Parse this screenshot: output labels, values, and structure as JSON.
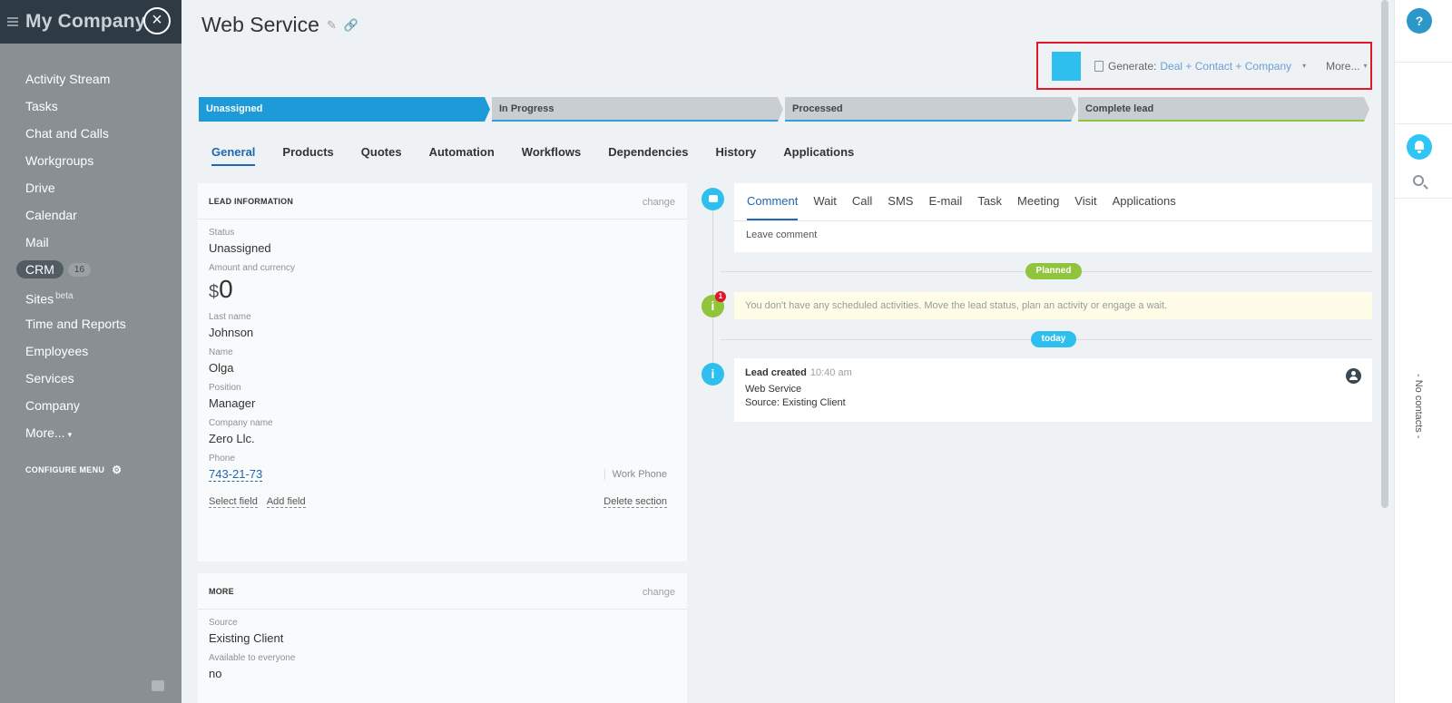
{
  "sidebar": {
    "company": "My Company",
    "close_icon": "×",
    "items": [
      {
        "label": "Activity Stream"
      },
      {
        "label": "Tasks"
      },
      {
        "label": "Chat and Calls"
      },
      {
        "label": "Workgroups"
      },
      {
        "label": "Drive"
      },
      {
        "label": "Calendar"
      },
      {
        "label": "Mail"
      }
    ],
    "crm": {
      "label": "CRM",
      "count": "16"
    },
    "sites": {
      "label": "Sites",
      "badge": "beta"
    },
    "items_after": [
      {
        "label": "Time and Reports"
      },
      {
        "label": "Employees"
      },
      {
        "label": "Services"
      },
      {
        "label": "Company"
      }
    ],
    "more": "More...",
    "more_caret": "▾",
    "configure": "CONFIGURE MENU",
    "gear": "⚙"
  },
  "header": {
    "title": "Web Service",
    "edit_icon": "✎",
    "link_icon": "🔗"
  },
  "toolbar": {
    "accent": "#2fbfee",
    "generate_label": "Generate:",
    "generate_value": "Deal + Contact + Company",
    "caret": "▾",
    "more": "More..."
  },
  "stages": [
    {
      "label": "Unassigned"
    },
    {
      "label": "In Progress"
    },
    {
      "label": "Processed"
    },
    {
      "label": "Complete lead"
    }
  ],
  "tabs": [
    "General",
    "Products",
    "Quotes",
    "Automation",
    "Workflows",
    "Dependencies",
    "History",
    "Applications"
  ],
  "lead_info": {
    "title": "LEAD INFORMATION",
    "change": "change",
    "status_label": "Status",
    "status_value": "Unassigned",
    "amount_label": "Amount and currency",
    "currency": "$",
    "amount": "0",
    "last_name_label": "Last name",
    "last_name": "Johnson",
    "name_label": "Name",
    "name": "Olga",
    "position_label": "Position",
    "position": "Manager",
    "company_label": "Company name",
    "company": "Zero Llc.",
    "phone_label": "Phone",
    "phone": "743-21-73",
    "phone_type": "Work Phone",
    "select_field": "Select field",
    "add_field": "Add field",
    "delete_section": "Delete section"
  },
  "more_section": {
    "title": "MORE",
    "change": "change",
    "source_label": "Source",
    "source": "Existing Client",
    "available_label": "Available to everyone",
    "available": "no"
  },
  "activity": {
    "tabs": [
      "Comment",
      "Wait",
      "Call",
      "SMS",
      "E-mail",
      "Task",
      "Meeting",
      "Visit",
      "Applications"
    ],
    "placeholder": "Leave comment",
    "planned": "Planned",
    "notice_badge": "1",
    "notice": "You don't have any scheduled activities. Move the lead status, plan an activity or engage a wait.",
    "today": "today",
    "info_icon": "i",
    "event_title": "Lead created",
    "event_time": "10:40 am",
    "event_line1": "Web Service",
    "event_line2": "Source: Existing Client"
  },
  "right_panel": {
    "help": "?",
    "no_contacts": "- No contacts -"
  }
}
